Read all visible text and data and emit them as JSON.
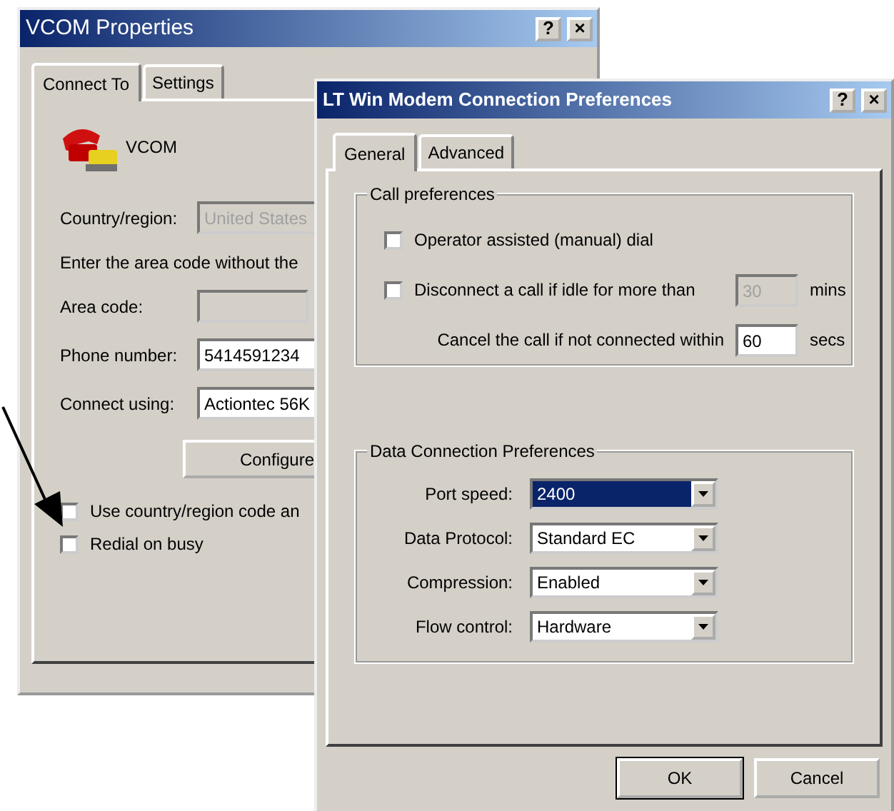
{
  "back_window": {
    "title": "VCOM Properties",
    "title_buttons": [
      "?",
      "×"
    ],
    "tabs": [
      {
        "label": "Connect To",
        "selected": true
      },
      {
        "label": "Settings",
        "selected": false
      }
    ],
    "connection_name": "VCOM",
    "country": {
      "label": "Country/region:",
      "value": "United States",
      "disabled": true
    },
    "instruction": "Enter the area code without the",
    "fields": [
      {
        "label": "Area code:",
        "disabled": true
      },
      {
        "label": "Phone number:",
        "value": "5414591234",
        "disabled": false
      },
      {
        "label": "Connect using:",
        "value": "Actiontec 56K",
        "disabled": false
      }
    ],
    "configure_button": "Configure",
    "checkboxes": [
      {
        "label": "Use country/region code an",
        "checked": false
      },
      {
        "label": "Redial on busy",
        "checked": false
      }
    ]
  },
  "front_window": {
    "title": "LT Win Modem Connection Preferences",
    "title_buttons": [
      "?",
      "×"
    ],
    "tabs": [
      {
        "label": "General",
        "selected": true
      },
      {
        "label": "Advanced",
        "selected": false
      }
    ],
    "call_preferences": {
      "title": "Call preferences",
      "rows": [
        {
          "kind": "checkbox",
          "label": "Operator assisted (manual) dial",
          "checked": false
        },
        {
          "kind": "checkbox-field",
          "label": "Disconnect a call if idle for more than",
          "checked": false,
          "value": "30",
          "disabled": true,
          "unit": "mins"
        },
        {
          "kind": "field",
          "label": "Cancel the call if not connected within",
          "value": "60",
          "disabled": false,
          "unit": "secs"
        }
      ]
    },
    "data_connection": {
      "title": "Data Connection Preferences",
      "rows": [
        {
          "label": "Port speed:",
          "value": "2400",
          "selected": true
        },
        {
          "label": "Data Protocol:",
          "value": "Standard EC",
          "selected": false
        },
        {
          "label": "Compression:",
          "value": "Enabled",
          "selected": false
        },
        {
          "label": "Flow control:",
          "value": "Hardware",
          "selected": false
        }
      ]
    },
    "buttons": [
      {
        "label": "OK",
        "default": true
      },
      {
        "label": "Cancel",
        "default": false
      }
    ]
  }
}
